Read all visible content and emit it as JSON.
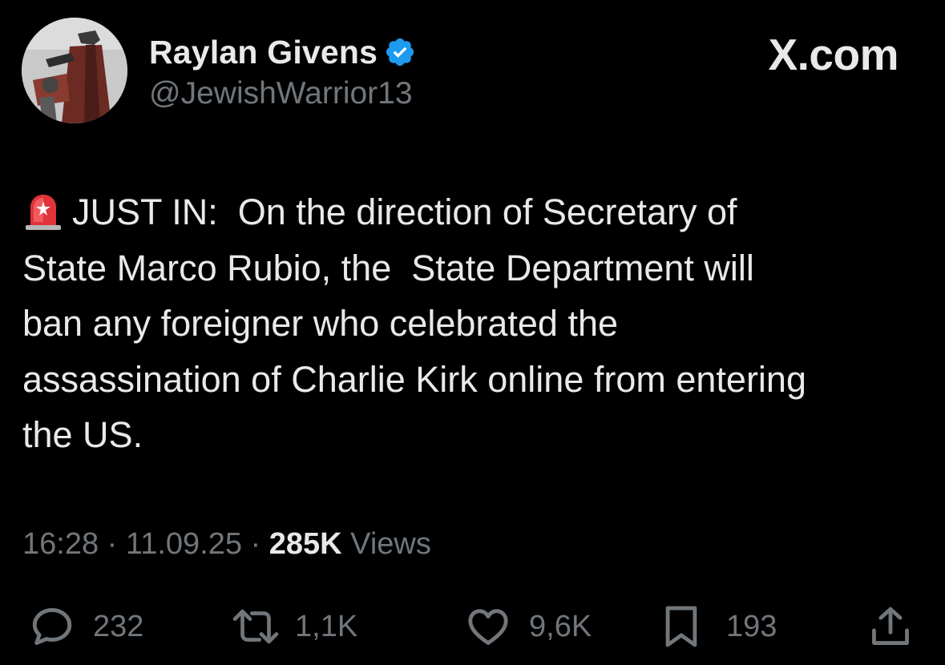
{
  "author": {
    "display_name": "Raylan Givens",
    "handle": "@JewishWarrior13",
    "verified": true
  },
  "brand": "X.com",
  "post": {
    "leading_emoji": "police-siren-icon",
    "text": "JUST IN:  On the direction of Secretary of\nState Marco Rubio, the  State Department will\nban any foreigner who celebrated the\nassassination of Charlie Kirk online from entering\nthe US."
  },
  "meta": {
    "time": "16:28",
    "separator": "·",
    "date": "11.09.25",
    "views_count": "285K",
    "views_label": "Views"
  },
  "actions": {
    "replies": "232",
    "reposts": "1,1K",
    "likes": "9,6K",
    "bookmarks": "193"
  },
  "colors": {
    "background": "#000000",
    "primary_text": "#e7e9ea",
    "secondary_text": "#71767b",
    "verified_badge": "#1d9bf0",
    "siren": "#e0333a"
  }
}
